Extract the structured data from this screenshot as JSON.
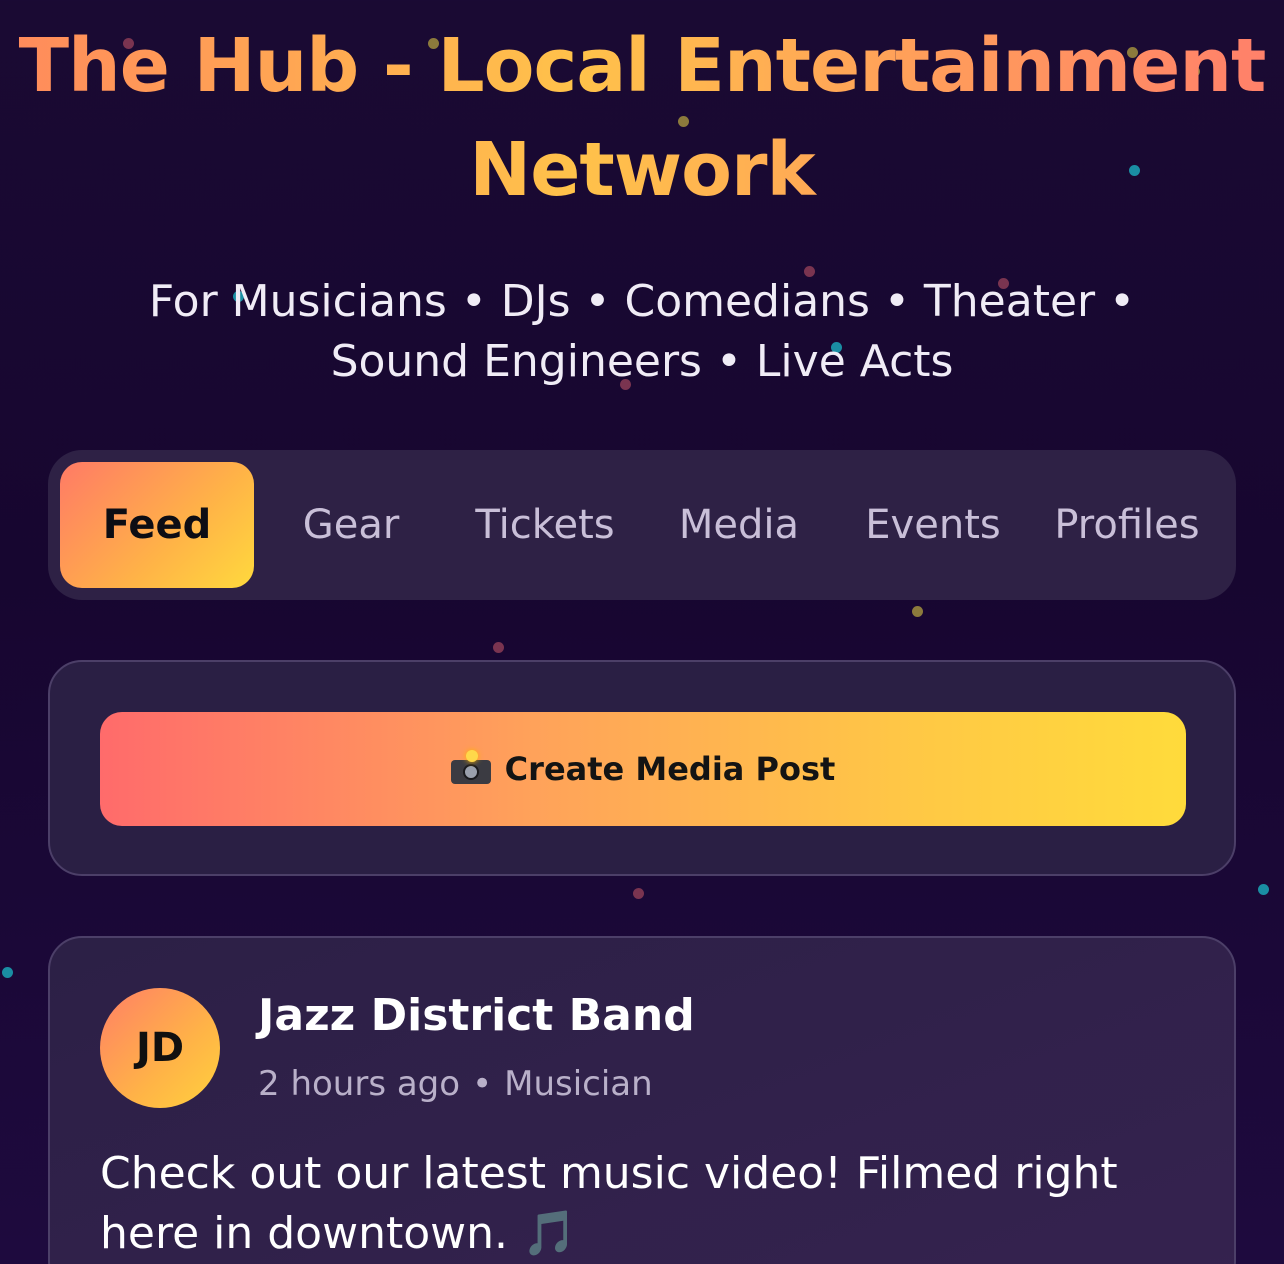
{
  "header": {
    "title": "The Hub - Local Entertainment Network",
    "subtitle": "For Musicians • DJs • Comedians • Theater • Sound Engineers • Live Acts"
  },
  "nav": {
    "tabs": [
      {
        "label": "Feed",
        "active": true
      },
      {
        "label": "Gear",
        "active": false
      },
      {
        "label": "Tickets",
        "active": false
      },
      {
        "label": "Media",
        "active": false
      },
      {
        "label": "Events",
        "active": false
      },
      {
        "label": "Profiles",
        "active": false
      }
    ]
  },
  "composer": {
    "button_label": "Create Media Post",
    "button_icon": "camera-flash-icon"
  },
  "posts": [
    {
      "avatar_initials": "JD",
      "author": "Jazz District Band",
      "time": "2 hours ago",
      "separator": "•",
      "role": "Musician",
      "text": "Check out our latest music video! Filmed right here in downtown. 🎵"
    }
  ],
  "colors": {
    "background": "#1a0a33",
    "accent_start": "#ff6b6b",
    "accent_end": "#ffdb3b",
    "card": "#2a1f44",
    "card_border": "#4c3f68"
  }
}
